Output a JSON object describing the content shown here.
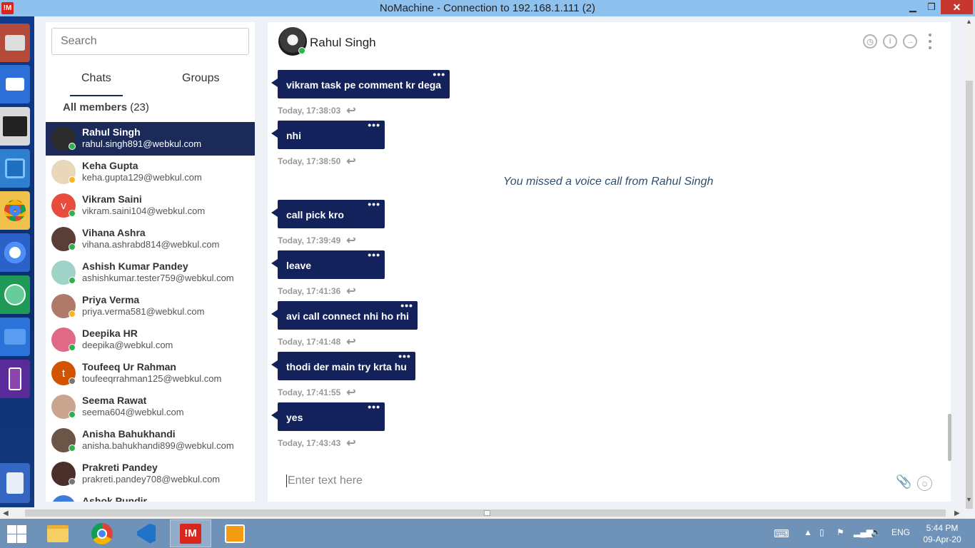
{
  "window": {
    "title": "NoMachine - Connection to 192.168.1.111 (2)",
    "app_icon": "!M",
    "minimize_icon": "minimize-icon",
    "maximize_icon": "restore-icon",
    "close_icon": "close-icon"
  },
  "sidebar": {
    "search_placeholder": "Search",
    "tabs": [
      {
        "label": "Chats",
        "active": true
      },
      {
        "label": "Groups",
        "active": false
      }
    ],
    "all_members_label": "All members",
    "all_members_count": "(23)",
    "contacts": [
      {
        "name": "Rahul Singh",
        "email": "rahul.singh891@webkul.com",
        "status": "online",
        "avatar_color": "#2b2b2b",
        "initial": "",
        "active": true
      },
      {
        "name": "Keha Gupta",
        "email": "keha.gupta129@webkul.com",
        "status": "away",
        "avatar_color": "#e8d7b8",
        "initial": ""
      },
      {
        "name": "Vikram Saini",
        "email": "vikram.saini104@webkul.com",
        "status": "online",
        "avatar_color": "#e74c3c",
        "initial": "v"
      },
      {
        "name": "Vihana Ashra",
        "email": "vihana.ashrabd814@webkul.com",
        "status": "online",
        "avatar_color": "#5a3e36",
        "initial": ""
      },
      {
        "name": "Ashish Kumar Pandey",
        "email": "ashishkumar.tester759@webkul.com",
        "status": "online",
        "avatar_color": "#9fd3c7",
        "initial": ""
      },
      {
        "name": "Priya Verma",
        "email": "priya.verma581@webkul.com",
        "status": "away",
        "avatar_color": "#b07a6a",
        "initial": ""
      },
      {
        "name": "Deepika HR",
        "email": "deepika@webkul.com",
        "status": "online",
        "avatar_color": "#e06a86",
        "initial": ""
      },
      {
        "name": "Toufeeq Ur Rahman",
        "email": "toufeeqrrahman125@webkul.com",
        "status": "offline",
        "avatar_color": "#d35400",
        "initial": "t"
      },
      {
        "name": "Seema Rawat",
        "email": "seema604@webkul.com",
        "status": "online",
        "avatar_color": "#c9a48e",
        "initial": ""
      },
      {
        "name": "Anisha Bahukhandi",
        "email": "anisha.bahukhandi899@webkul.com",
        "status": "online",
        "avatar_color": "#6b5547",
        "initial": ""
      },
      {
        "name": "Prakreti Pandey",
        "email": "prakreti.pandey708@webkul.com",
        "status": "offline",
        "avatar_color": "#4a2f2a",
        "initial": ""
      },
      {
        "name": "Ashok Pundir",
        "email": "",
        "status": "",
        "avatar_color": "#3b7dd8",
        "initial": ""
      }
    ],
    "status_colors": {
      "online": "#2fb24b",
      "away": "#f5b622",
      "offline": "#777777"
    }
  },
  "chat": {
    "contact_name": "Rahul Singh",
    "header_icons": [
      "history-icon",
      "info-icon",
      "forward-icon",
      "more-icon"
    ],
    "messages": [
      {
        "text": "vikram task pe comment kr dega",
        "time": "Today, 17:38:03"
      },
      {
        "text": "nhi",
        "time": "Today, 17:38:50"
      },
      {
        "text": "call pick kro",
        "time": "Today, 17:39:49"
      },
      {
        "text": "leave",
        "time": "Today, 17:41:36"
      },
      {
        "text": "avi call connect nhi ho rhi",
        "time": "Today, 17:41:48"
      },
      {
        "text": "thodi der main try krta hu",
        "time": "Today, 17:41:55"
      },
      {
        "text": "yes",
        "time": "Today, 17:43:43"
      }
    ],
    "missed_call_text": "You missed a voice call from Rahul Singh",
    "input_placeholder": "Enter text here",
    "attach_icon": "paperclip-icon",
    "emoji_icon": "emoji-icon"
  },
  "taskbar": {
    "language": "ENG",
    "time": "5:44 PM",
    "date": "09-Apr-20",
    "apps": [
      "file-explorer-icon",
      "chrome-icon",
      "vscode-icon",
      "nomachine-icon",
      "media-player-icon"
    ]
  }
}
